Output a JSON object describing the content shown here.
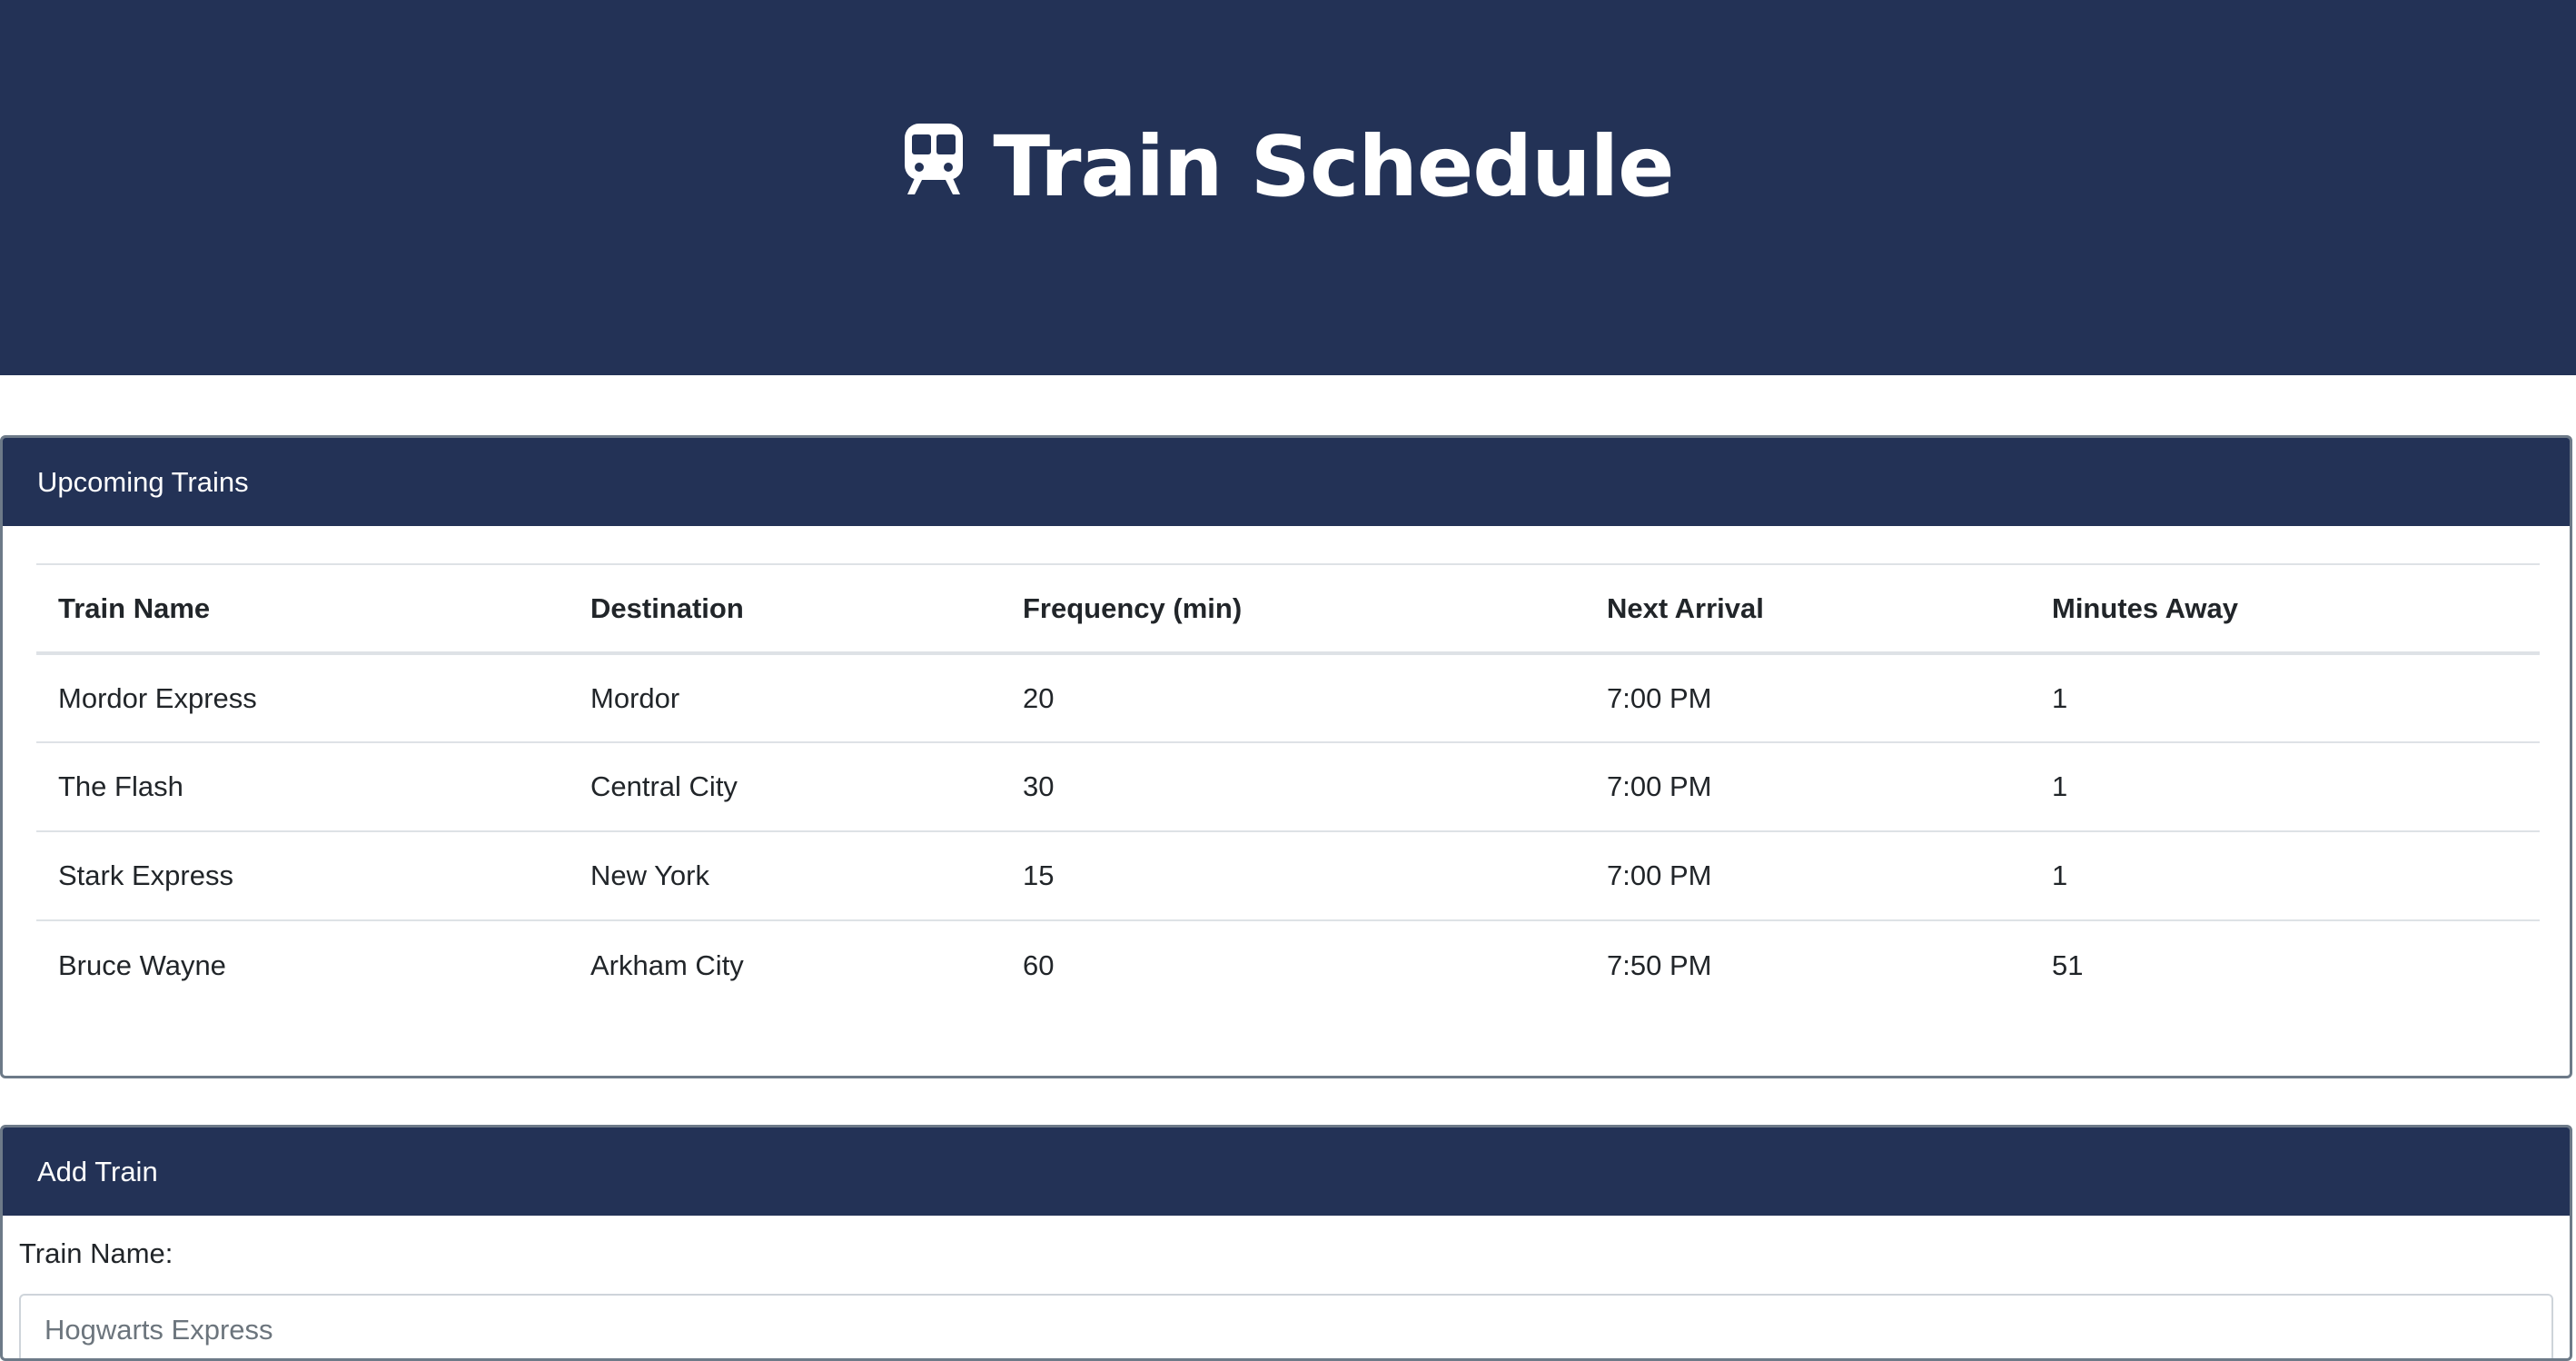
{
  "header": {
    "title": "Train Schedule",
    "icon": "train-icon",
    "background": "#233256"
  },
  "upcoming": {
    "heading": "Upcoming Trains",
    "columns": [
      "Train Name",
      "Destination",
      "Frequency (min)",
      "Next Arrival",
      "Minutes Away"
    ],
    "rows": [
      [
        "Mordor Express",
        "Mordor",
        "20",
        "7:00 PM",
        "1"
      ],
      [
        "The Flash",
        "Central City",
        "30",
        "7:00 PM",
        "1"
      ],
      [
        "Stark Express",
        "New York",
        "15",
        "7:00 PM",
        "1"
      ],
      [
        "Bruce Wayne",
        "Arkham City",
        "60",
        "7:50 PM",
        "51"
      ]
    ]
  },
  "add_train": {
    "heading": "Add Train",
    "train_name_label": "Train Name:",
    "train_name_placeholder": "Hogwarts Express"
  }
}
